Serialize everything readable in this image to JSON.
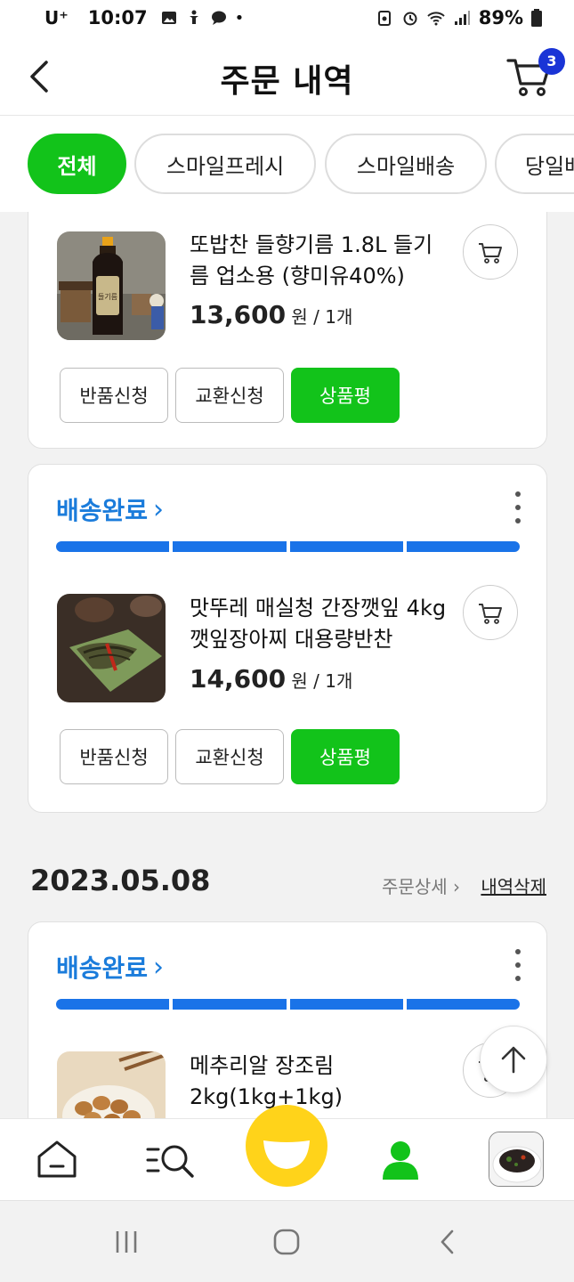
{
  "status_bar": {
    "carrier": "U⁺",
    "time": "10:07",
    "battery": "89%"
  },
  "header": {
    "title": "주문 내역",
    "cart_count": "3"
  },
  "filters": [
    {
      "label": "전체",
      "active": true
    },
    {
      "label": "스마일프레시",
      "active": false
    },
    {
      "label": "스마일배송",
      "active": false
    },
    {
      "label": "당일배",
      "active": false
    }
  ],
  "orders": [
    {
      "product": {
        "name": "또밥찬 들향기름 1.8L 들기름 업소용 (향미유40%)",
        "price": "13,600",
        "unit": " 원 / 1개"
      },
      "buttons": [
        "반품신청",
        "교환신청",
        "상품평"
      ]
    },
    {
      "status": "배송완료",
      "progress": 4,
      "product": {
        "name": "맛뚜레 매실청 간장깻잎 4kg 깻잎장아찌 대용량반찬",
        "price": "14,600",
        "unit": " 원 / 1개"
      },
      "buttons": [
        "반품신청",
        "교환신청",
        "상품평"
      ]
    }
  ],
  "date_group": {
    "date": "2023.05.08",
    "detail_link": "주문상세 ›",
    "delete_link": "내역삭제"
  },
  "order3": {
    "status": "배송완료",
    "product": {
      "name": "메추리알 장조림 2kg(1kg+1kg)"
    }
  },
  "colors": {
    "green": "#12c31a",
    "blue": "#1b7cdb",
    "badge": "#1a34d6",
    "smile": "#ffd31a"
  }
}
